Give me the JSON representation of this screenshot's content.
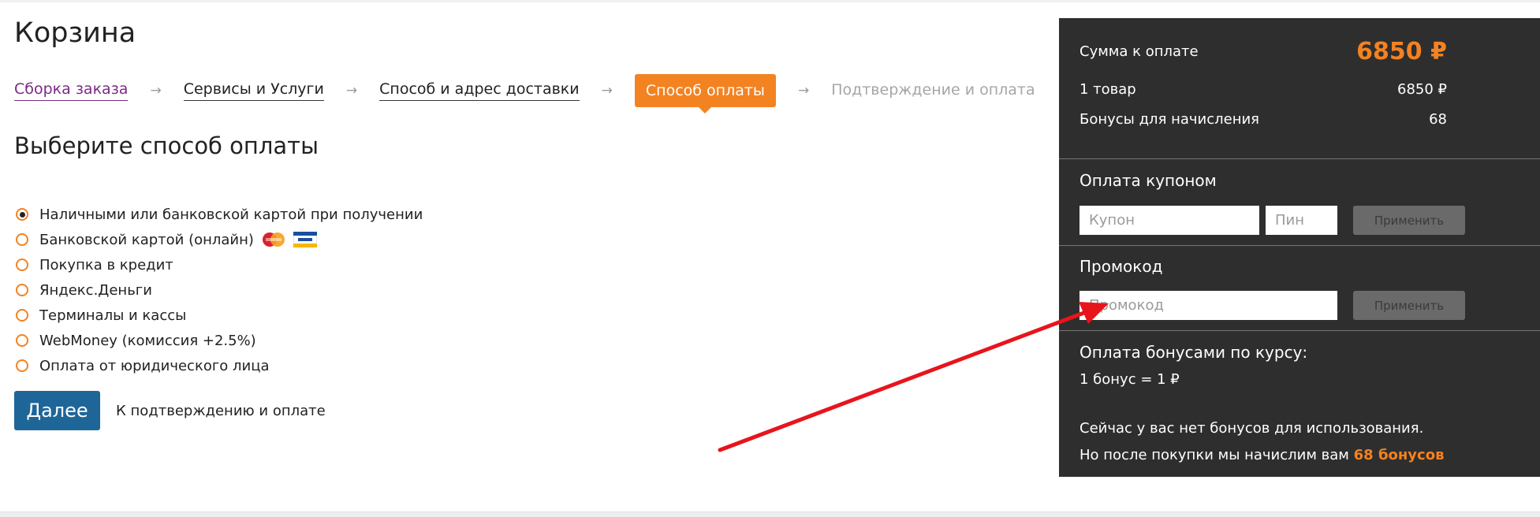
{
  "page": {
    "title": "Корзина",
    "subtitle": "Выберите способ оплаты"
  },
  "steps": [
    {
      "label": "Сборка заказа"
    },
    {
      "label": "Сервисы и Услуги"
    },
    {
      "label": "Способ и адрес доставки"
    },
    {
      "label": "Способ оплаты"
    },
    {
      "label": "Подтверждение и оплата"
    }
  ],
  "step_arrow": "→",
  "payment_options": [
    {
      "label": "Наличными или банковской картой при получении",
      "checked": true
    },
    {
      "label": "Банковской картой (онлайн)",
      "checked": false
    },
    {
      "label": "Покупка в кредит",
      "checked": false
    },
    {
      "label": "Яндекс.Деньги",
      "checked": false
    },
    {
      "label": "Терминалы и кассы",
      "checked": false
    },
    {
      "label": "WebMoney (комиссия +2.5%)",
      "checked": false
    },
    {
      "label": "Оплата от юридического лица",
      "checked": false
    }
  ],
  "card_icons": [
    "mastercard-icon",
    "visa-icon"
  ],
  "next": {
    "button_label": "Далее",
    "caption": "К подтверждению и оплате"
  },
  "summary": {
    "total_label": "Сумма к оплате",
    "total_value": "6850 ₽",
    "items_label": "1 товар",
    "items_value": "6850 ₽",
    "bonus_label": "Бонусы для начисления",
    "bonus_value": "68"
  },
  "coupon": {
    "title": "Оплата купоном",
    "coupon_placeholder": "Купон",
    "pin_placeholder": "Пин",
    "apply_label": "Применить"
  },
  "promo": {
    "title": "Промокод",
    "placeholder": "Промокод",
    "apply_label": "Применить"
  },
  "bonus_payment": {
    "title": "Оплата бонусами по курсу:",
    "rate": "1 бонус = 1  ₽",
    "no_bonus_text": "Сейчас у вас нет бонусов для использования.",
    "after_purchase_text": "Но после покупки мы начислим вам",
    "after_purchase_amount": "68 бонусов"
  },
  "colors": {
    "accent": "#f38221",
    "primary_button": "#1f6698",
    "sidebar_bg": "#2e2e2e",
    "annotation_arrow": "#e8141c"
  }
}
